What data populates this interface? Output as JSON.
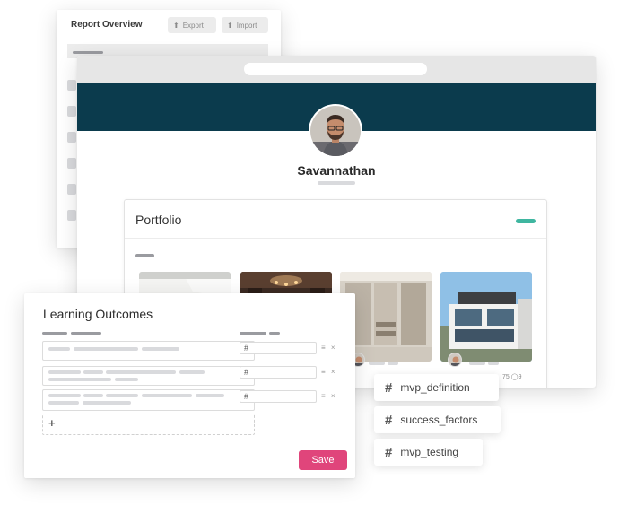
{
  "report": {
    "title": "Report Overview",
    "export_label": "Export",
    "import_label": "Import"
  },
  "profile": {
    "name": "Savannathan",
    "portfolio": {
      "title": "Portfolio",
      "items": [
        {
          "image": "white-interior"
        },
        {
          "image": "dark-restaurant-interior"
        },
        {
          "image": "walk-in-closet",
          "stats": ""
        },
        {
          "image": "modern-house",
          "stats": "75  ◯9"
        }
      ]
    }
  },
  "learning": {
    "title": "Learning Outcomes",
    "rows": [
      {
        "hash": "#",
        "actions": "≡ ×"
      },
      {
        "hash": "#",
        "actions": "≡ ×"
      },
      {
        "hash": "#",
        "actions": "≡ ×"
      }
    ],
    "add_label": "+",
    "save_label": "Save"
  },
  "tags": [
    {
      "hash": "#",
      "label": "mvp_definition"
    },
    {
      "hash": "#",
      "label": "success_factors"
    },
    {
      "hash": "#",
      "label": "mvp_testing"
    }
  ],
  "colors": {
    "banner": "#0b3b4d",
    "accent_teal": "#3fb6a0",
    "save_pink": "#e0457b"
  }
}
